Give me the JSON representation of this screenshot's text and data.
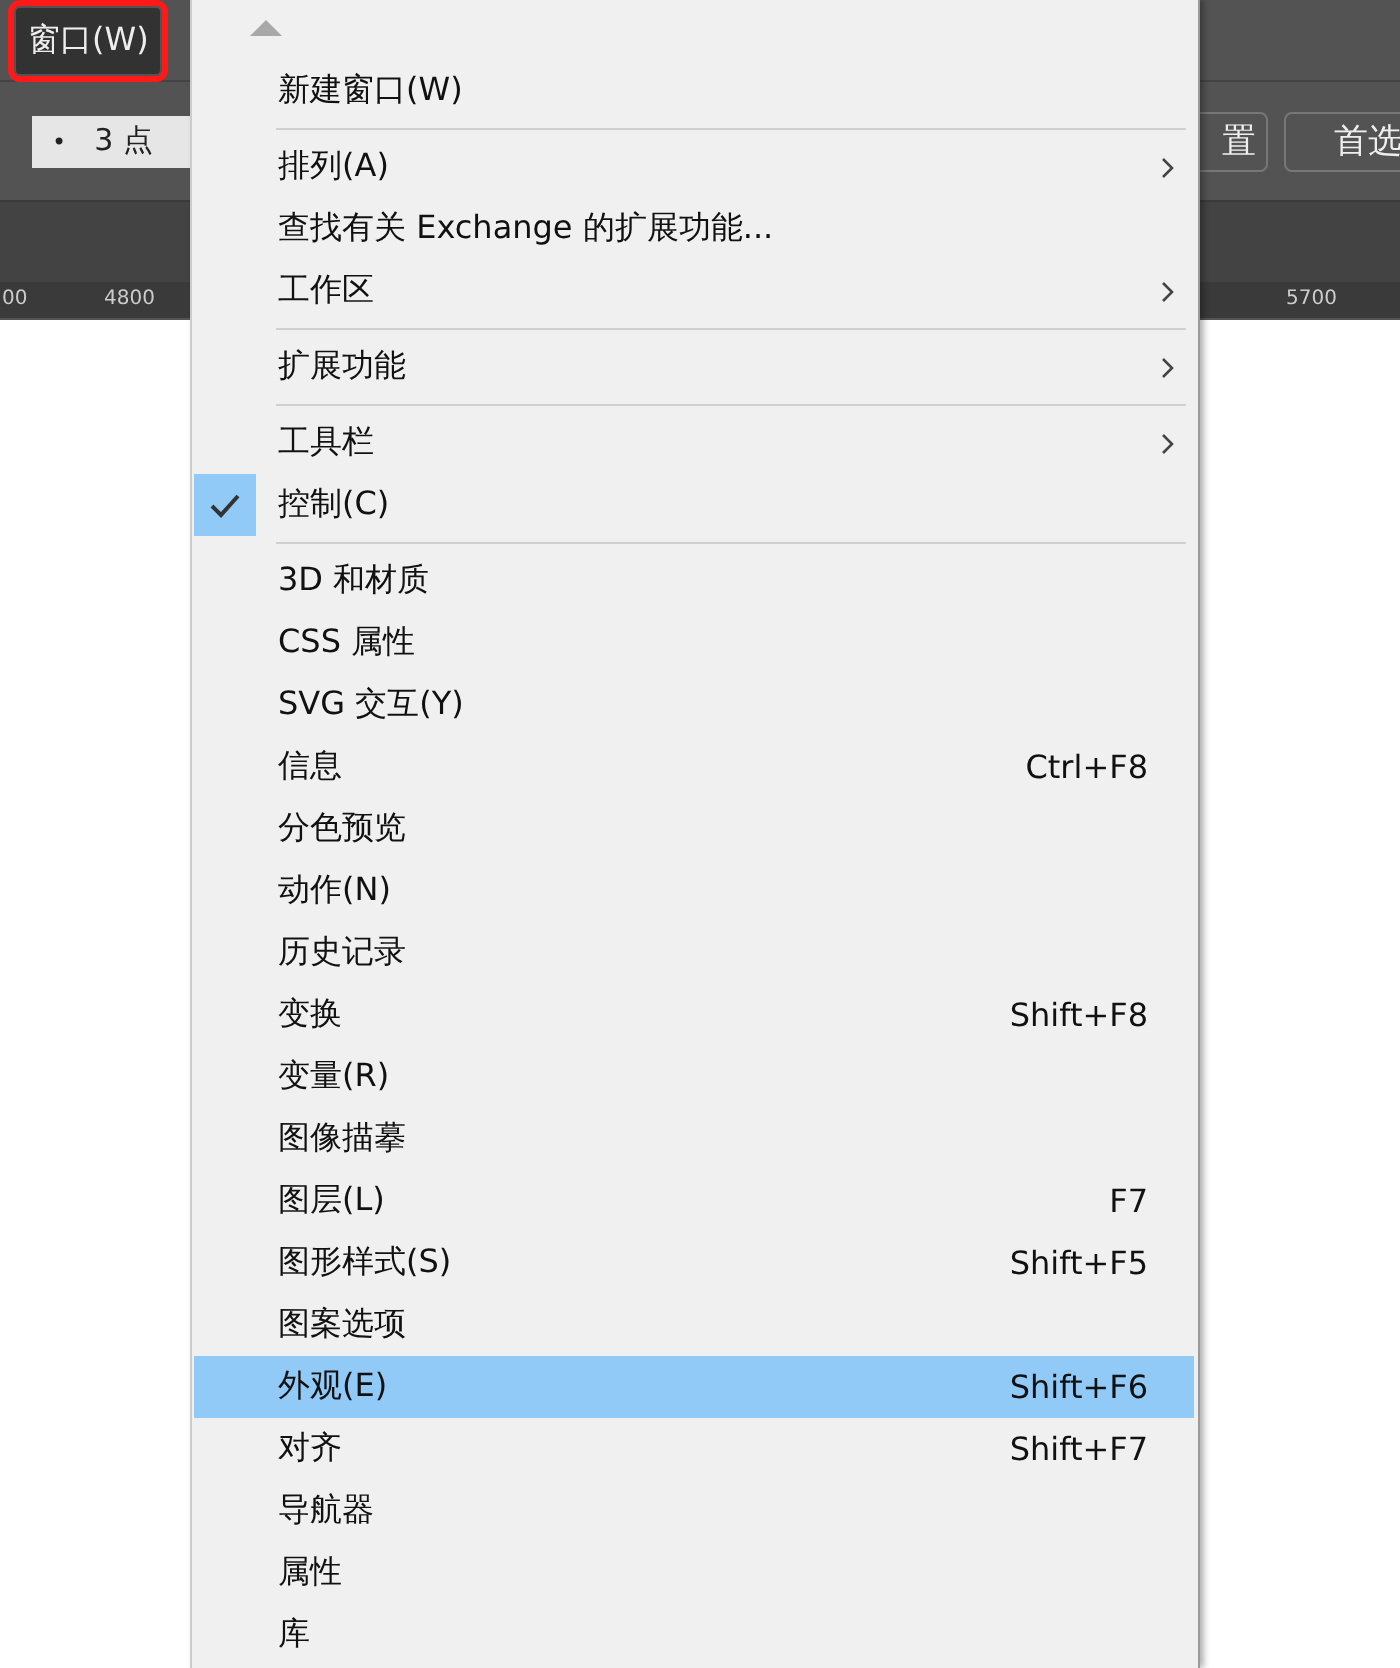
{
  "menubar": {
    "items": [
      {
        "label": "窗口(W)",
        "selected": true
      }
    ]
  },
  "control_bar": {
    "field": {
      "bullet": "•",
      "value": "3 点"
    },
    "buttons": [
      "置",
      "首选"
    ]
  },
  "ruler": {
    "labels": [
      "00",
      "4800",
      "5700"
    ]
  },
  "menu": {
    "items": [
      {
        "kind": "item",
        "label": "新建窗口(W)"
      },
      {
        "kind": "separator"
      },
      {
        "kind": "item",
        "label": "排列(A)",
        "submenu": true
      },
      {
        "kind": "item",
        "label": "查找有关 Exchange 的扩展功能..."
      },
      {
        "kind": "item",
        "label": "工作区",
        "submenu": true
      },
      {
        "kind": "separator"
      },
      {
        "kind": "item",
        "label": "扩展功能",
        "submenu": true
      },
      {
        "kind": "separator"
      },
      {
        "kind": "item",
        "label": "工具栏",
        "submenu": true
      },
      {
        "kind": "item",
        "label": "控制(C)",
        "checked": true
      },
      {
        "kind": "separator"
      },
      {
        "kind": "item",
        "label": "3D 和材质"
      },
      {
        "kind": "item",
        "label": "CSS 属性"
      },
      {
        "kind": "item",
        "label": "SVG 交互(Y)"
      },
      {
        "kind": "item",
        "label": "信息",
        "shortcut": "Ctrl+F8"
      },
      {
        "kind": "item",
        "label": "分色预览"
      },
      {
        "kind": "item",
        "label": "动作(N)"
      },
      {
        "kind": "item",
        "label": "历史记录"
      },
      {
        "kind": "item",
        "label": "变换",
        "shortcut": "Shift+F8"
      },
      {
        "kind": "item",
        "label": "变量(R)"
      },
      {
        "kind": "item",
        "label": "图像描摹"
      },
      {
        "kind": "item",
        "label": "图层(L)",
        "shortcut": "F7"
      },
      {
        "kind": "item",
        "label": "图形样式(S)",
        "shortcut": "Shift+F5"
      },
      {
        "kind": "item",
        "label": "图案选项"
      },
      {
        "kind": "item",
        "label": "外观(E)",
        "shortcut": "Shift+F6",
        "highlighted": true
      },
      {
        "kind": "item",
        "label": "对齐",
        "shortcut": "Shift+F7"
      },
      {
        "kind": "item",
        "label": "导航器"
      },
      {
        "kind": "item",
        "label": "属性"
      },
      {
        "kind": "item",
        "label": "库"
      }
    ]
  }
}
